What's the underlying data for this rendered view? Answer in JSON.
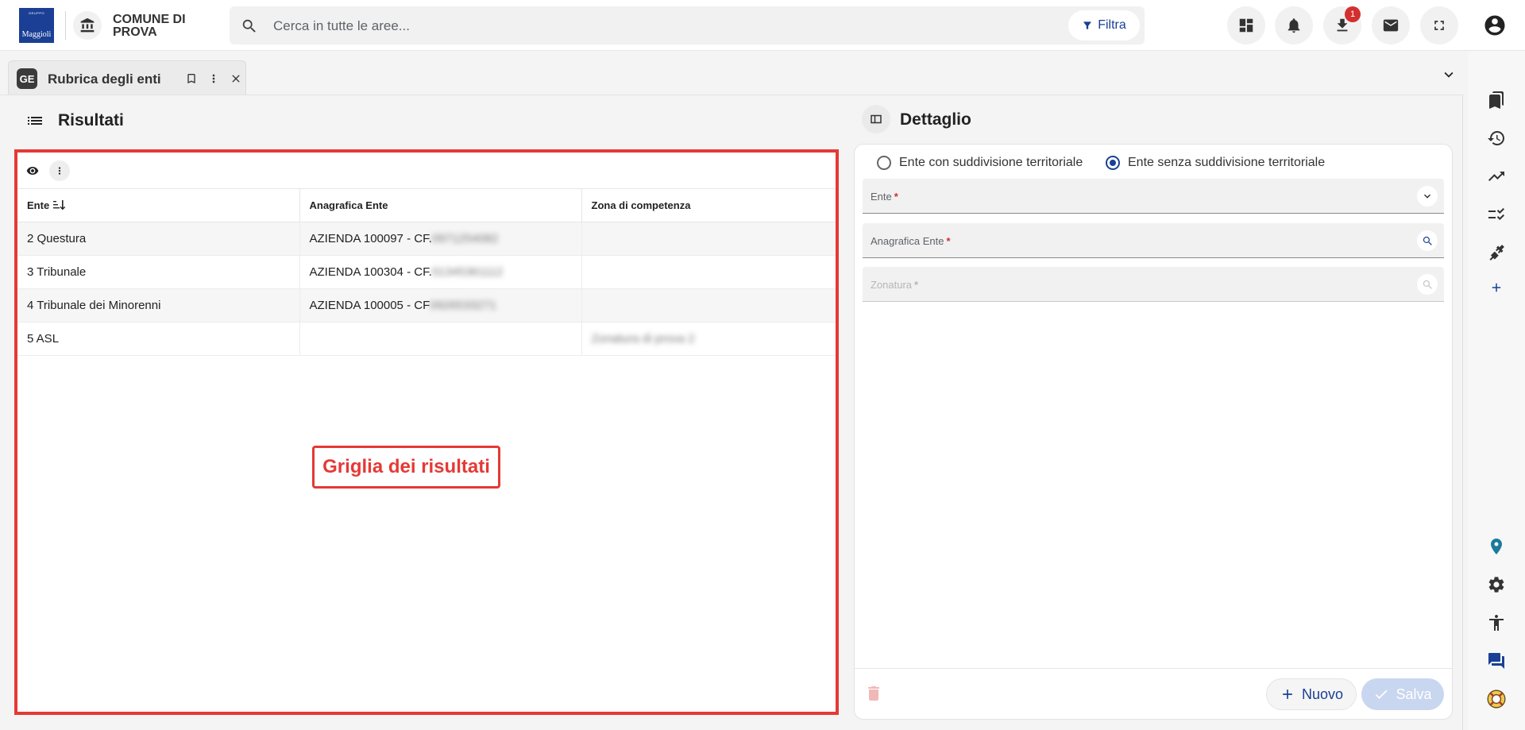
{
  "header": {
    "logo_small": "GRUPPO",
    "logo_big": "Maggioli",
    "comune_name": "COMUNE DI PROVA",
    "search_placeholder": "Cerca in tutte le aree...",
    "filter_label": "Filtra",
    "download_badge": "1"
  },
  "tab": {
    "icon_text": "GE",
    "label": "Rubrica degli enti"
  },
  "results": {
    "title": "Risultati",
    "columns": [
      "Ente",
      "Anagrafica Ente",
      "Zona di competenza"
    ],
    "rows": [
      {
        "ente": "2 Questura",
        "anagrafica": "AZIENDA 100097 - CF.",
        "anagrafica_redacted": "0971254082",
        "zona": ""
      },
      {
        "ente": "3 Tribunale",
        "anagrafica": "AZIENDA 100304 - CF.",
        "anagrafica_redacted": "01345361112",
        "zona": ""
      },
      {
        "ente": "4 Tribunale dei Minorenni",
        "anagrafica": "AZIENDA 100005 - CF",
        "anagrafica_redacted": "0926533271",
        "zona": ""
      },
      {
        "ente": "5 ASL",
        "anagrafica": "",
        "anagrafica_redacted": "",
        "zona": "Zonatura di prova 2"
      }
    ],
    "annotation": "Griglia dei risultati"
  },
  "detail": {
    "title": "Dettaglio",
    "radio_with": "Ente con suddivisione territoriale",
    "radio_without": "Ente senza suddivisione territoriale",
    "radio_selected": "without",
    "field_ente": "Ente",
    "field_anagrafica": "Anagrafica Ente",
    "field_zonatura": "Zonatura",
    "required_mark": "*",
    "btn_nuovo": "Nuovo",
    "btn_salva": "Salva"
  },
  "colors": {
    "accent": "#1a3f95",
    "annotation": "#e53935",
    "required": "#d32f2f",
    "rail_blue": "#1b7a9e"
  }
}
